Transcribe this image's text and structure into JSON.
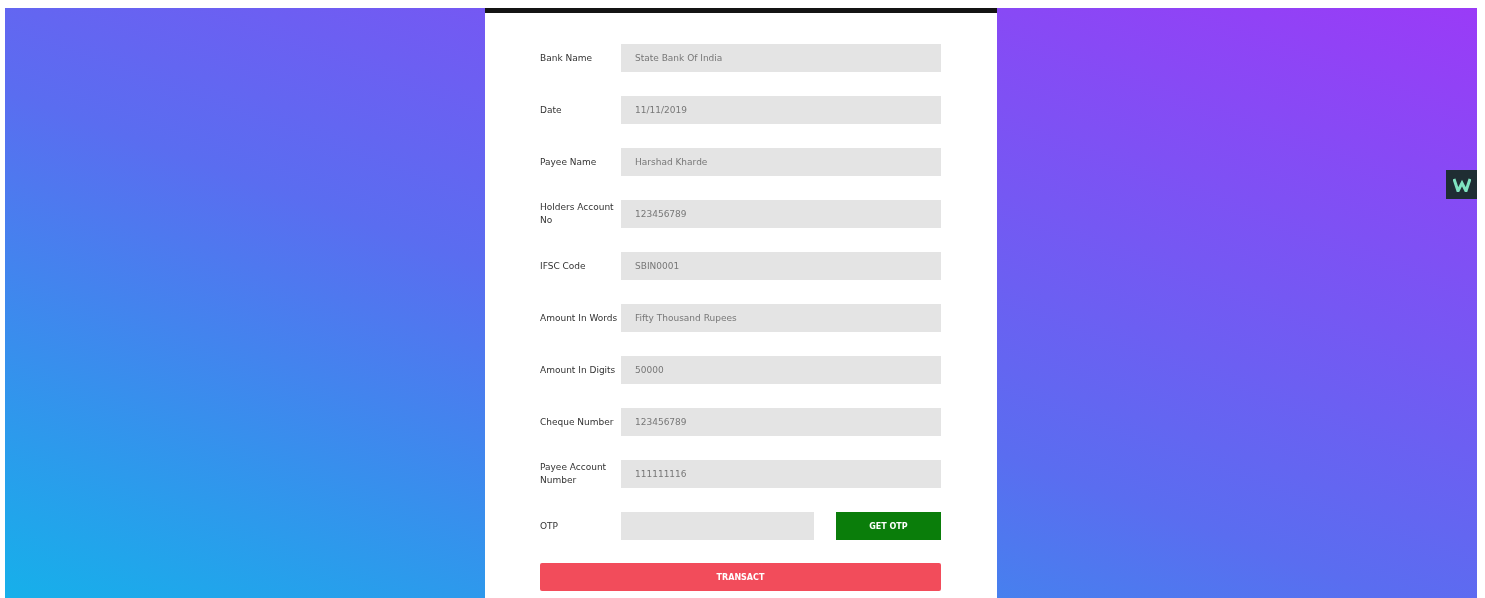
{
  "form": {
    "fields": [
      {
        "label": "Bank Name",
        "value": "State Bank Of India"
      },
      {
        "label": "Date",
        "value": "11/11/2019"
      },
      {
        "label": "Payee Name",
        "value": "Harshad Kharde"
      },
      {
        "label": "Holders Account No",
        "value": "123456789"
      },
      {
        "label": "IFSC Code",
        "value": "SBIN0001"
      },
      {
        "label": "Amount In Words",
        "value": "Fifty Thousand Rupees"
      },
      {
        "label": "Amount In Digits",
        "value": "50000"
      },
      {
        "label": "Cheque Number",
        "value": "123456789"
      },
      {
        "label": "Payee Account Number",
        "value": "111111116"
      }
    ],
    "otp": {
      "label": "OTP",
      "button": "GET OTP"
    },
    "submit": "TRANSACT"
  }
}
